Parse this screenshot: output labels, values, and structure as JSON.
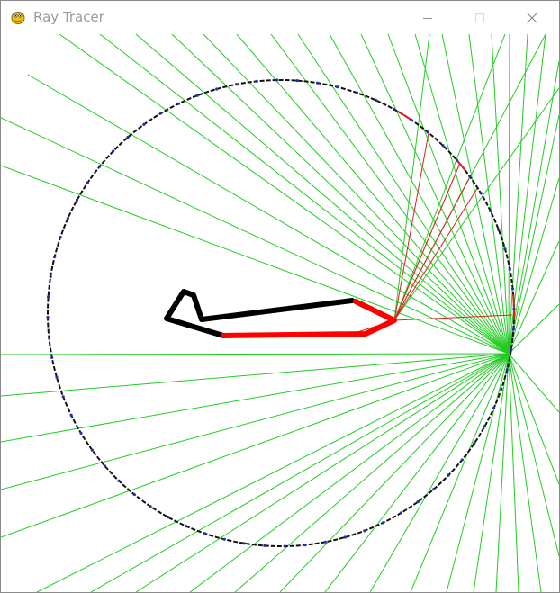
{
  "window": {
    "title": "Ray Tracer",
    "icons": {
      "app": "pygame-snake-icon",
      "minimize": "minimize-icon",
      "maximize": "maximize-icon",
      "close": "close-icon"
    }
  },
  "scene": {
    "colors": {
      "rays": "#22cc22",
      "reflected_rays": "#dd2222",
      "circle": "#111111",
      "circle_points": "#2233aa",
      "shape": "#000000",
      "shape_hit": "#ff0000"
    }
  }
}
